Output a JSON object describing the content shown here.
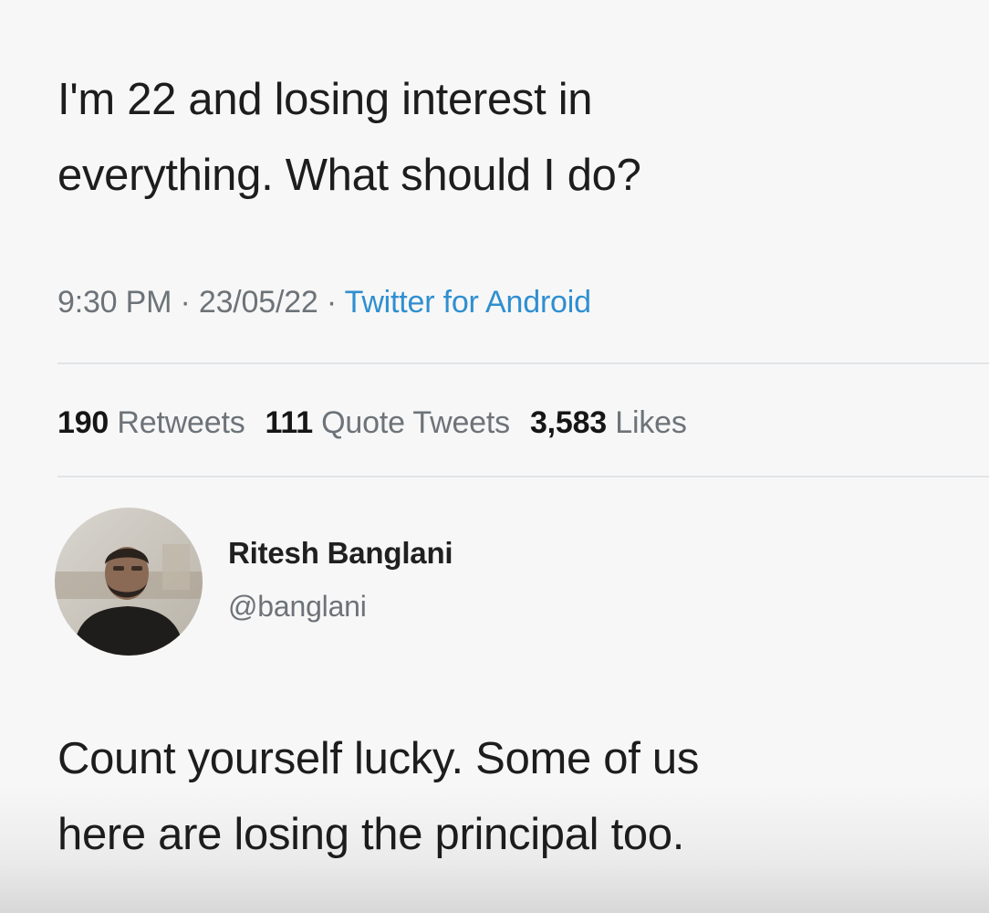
{
  "tweet": {
    "line1": "I'm 22 and losing interest in",
    "line2": "everything. What should I do?",
    "time": "9:30 PM",
    "sep1": " · ",
    "date": "23/05/22",
    "sep2": " · ",
    "source": "Twitter for Android"
  },
  "stats": {
    "retweets_count": "190",
    "retweets_label": "Retweets",
    "quotes_count": "111",
    "quotes_label": "Quote Tweets",
    "likes_count": "3,583",
    "likes_label": "Likes"
  },
  "reply": {
    "name": "Ritesh Banglani",
    "handle": "@banglani",
    "line1": "Count yourself lucky. Some of us",
    "line2": "here are losing the principal too."
  },
  "colors": {
    "background": "#f7f7f7",
    "text": "#1d1d1d",
    "muted": "#6d7378",
    "link": "#2f8fd0",
    "divider": "#e2e4e6"
  },
  "icons": {
    "avatar": "profile-photo"
  }
}
